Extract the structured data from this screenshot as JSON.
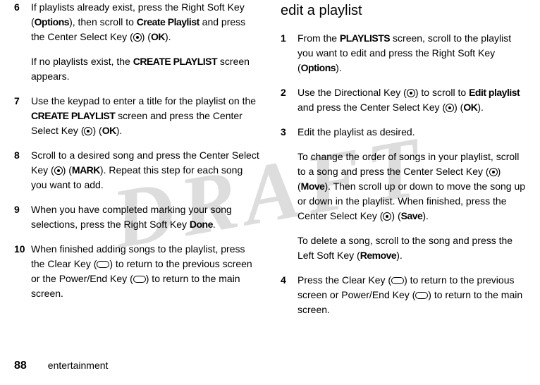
{
  "watermark": "DRAFT",
  "leftColumn": {
    "steps": [
      {
        "num": "6",
        "parts": [
          {
            "text": "If playlists already exist, press the Right Soft Key ("
          },
          {
            "text": "Options",
            "style": "condensed"
          },
          {
            "text": "), then scroll to "
          },
          {
            "text": "Create Playlist",
            "style": "condensed"
          },
          {
            "text": " and press the Center Select Key ("
          },
          {
            "icon": "circle"
          },
          {
            "text": ") ("
          },
          {
            "text": "OK",
            "style": "condensed"
          },
          {
            "text": ")."
          }
        ],
        "sub": [
          {
            "text": "If no playlists exist, the "
          },
          {
            "text": "CREATE PLAYLIST",
            "style": "condensed"
          },
          {
            "text": " screen appears."
          }
        ]
      },
      {
        "num": "7",
        "parts": [
          {
            "text": "Use the keypad to enter a title for the playlist on the "
          },
          {
            "text": "CREATE PLAYLIST",
            "style": "condensed"
          },
          {
            "text": " screen and press the Center Select Key ("
          },
          {
            "icon": "circle"
          },
          {
            "text": ") ("
          },
          {
            "text": "OK",
            "style": "condensed"
          },
          {
            "text": ")."
          }
        ]
      },
      {
        "num": "8",
        "parts": [
          {
            "text": "Scroll to a desired song and press the Center Select Key ("
          },
          {
            "icon": "circle"
          },
          {
            "text": ") ("
          },
          {
            "text": "MARK",
            "style": "condensed"
          },
          {
            "text": "). Repeat this step for each song you want to add."
          }
        ]
      },
      {
        "num": "9",
        "parts": [
          {
            "text": "When you have completed marking your song selections, press the Right Soft Key "
          },
          {
            "text": "Done",
            "style": "condensed"
          },
          {
            "text": "."
          }
        ]
      },
      {
        "num": "10",
        "parts": [
          {
            "text": "When finished adding songs to the playlist, press the Clear Key ("
          },
          {
            "icon": "key"
          },
          {
            "text": ") to return to the previous screen or the Power/End Key ("
          },
          {
            "icon": "key"
          },
          {
            "text": ") to return to the main screen."
          }
        ]
      }
    ]
  },
  "rightColumn": {
    "heading": "edit a playlist",
    "steps": [
      {
        "num": "1",
        "parts": [
          {
            "text": "From the "
          },
          {
            "text": "PLAYLISTS",
            "style": "condensed"
          },
          {
            "text": " screen, scroll to the playlist you want to edit and press the Right Soft Key ("
          },
          {
            "text": "Options",
            "style": "condensed"
          },
          {
            "text": ")."
          }
        ]
      },
      {
        "num": "2",
        "parts": [
          {
            "text": "Use the Directional Key ("
          },
          {
            "icon": "circle"
          },
          {
            "text": ") to scroll to "
          },
          {
            "text": "Edit playlist",
            "style": "condensed"
          },
          {
            "text": " and press the Center Select Key ("
          },
          {
            "icon": "circle"
          },
          {
            "text": ") ("
          },
          {
            "text": "OK",
            "style": "condensed"
          },
          {
            "text": ")."
          }
        ]
      },
      {
        "num": "3",
        "parts": [
          {
            "text": "Edit the playlist as desired."
          }
        ],
        "subs": [
          [
            {
              "text": "To change the order of songs in your playlist, scroll to a song and press the Center Select Key ("
            },
            {
              "icon": "circle"
            },
            {
              "text": ") ("
            },
            {
              "text": "Move",
              "style": "condensed"
            },
            {
              "text": "). Then scroll up or down to move the song up or down in the playlist. When finished, press the Center Select Key ("
            },
            {
              "icon": "circle"
            },
            {
              "text": ") ("
            },
            {
              "text": "Save",
              "style": "condensed"
            },
            {
              "text": ")."
            }
          ],
          [
            {
              "text": "To delete a song, scroll to the song and press the Left Soft Key ("
            },
            {
              "text": "Remove",
              "style": "condensed"
            },
            {
              "text": ")."
            }
          ]
        ]
      },
      {
        "num": "4",
        "parts": [
          {
            "text": "Press the Clear Key ("
          },
          {
            "icon": "key"
          },
          {
            "text": ") to return to the previous screen or Power/End Key ("
          },
          {
            "icon": "key"
          },
          {
            "text": ") to return to the main screen."
          }
        ]
      }
    ]
  },
  "footer": {
    "pageNum": "88",
    "section": "entertainment"
  }
}
